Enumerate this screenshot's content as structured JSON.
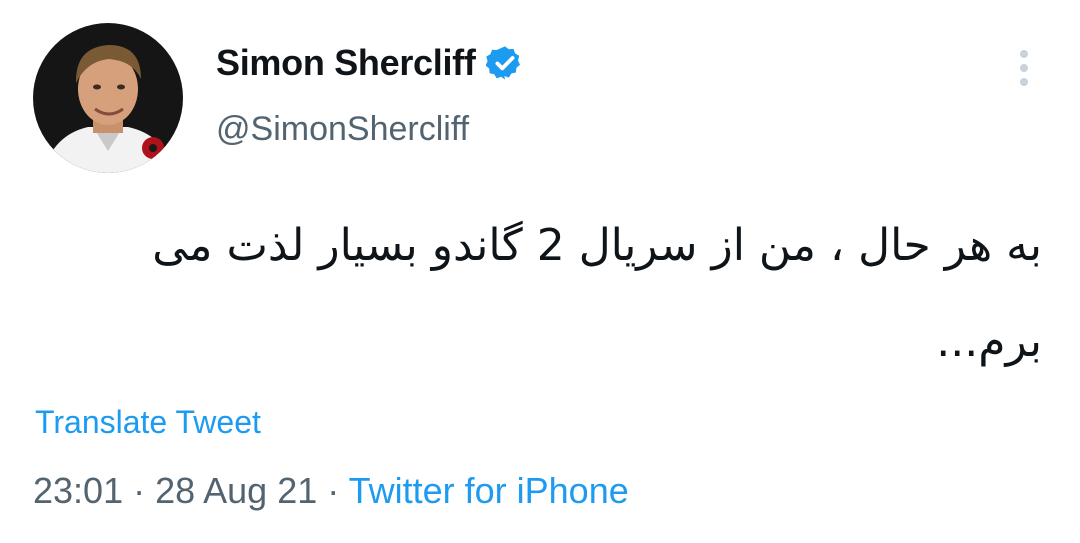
{
  "user": {
    "display_name": "Simon Shercliff",
    "handle": "@SimonShercliff",
    "verified": true,
    "verified_icon": "verified-badge-icon",
    "avatar_icon": "profile-photo-avatar"
  },
  "tweet": {
    "text": "به هر حال ، من از سریال 2 گاندو بسیار لذت می برم...",
    "translate_label": "Translate Tweet",
    "time": "23:01",
    "separator": " · ",
    "date": "28 Aug 21",
    "source": "Twitter for iPhone"
  },
  "menu": {
    "icon": "more-options-icon"
  },
  "colors": {
    "link": "#1d9bf0",
    "secondary_text": "#536471",
    "primary_text": "#0f1419"
  }
}
